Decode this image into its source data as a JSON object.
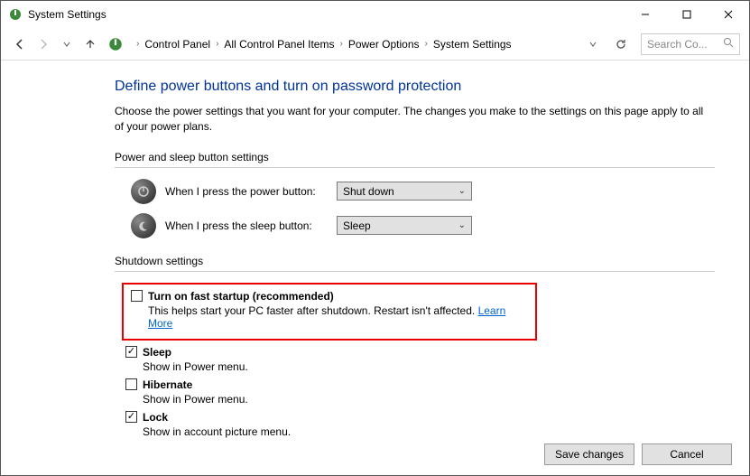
{
  "titlebar": {
    "title": "System Settings"
  },
  "breadcrumb": {
    "items": [
      "Control Panel",
      "All Control Panel Items",
      "Power Options",
      "System Settings"
    ]
  },
  "search": {
    "placeholder": "Search Co..."
  },
  "page": {
    "heading": "Define power buttons and turn on password protection",
    "description": "Choose the power settings that you want for your computer. The changes you make to the settings on this page apply to all of your power plans.",
    "section1_label": "Power and sleep button settings",
    "power_button_label": "When I press the power button:",
    "power_button_value": "Shut down",
    "sleep_button_label": "When I press the sleep button:",
    "sleep_button_value": "Sleep",
    "section2_label": "Shutdown settings",
    "fast_startup": {
      "title": "Turn on fast startup (recommended)",
      "sub": "This helps start your PC faster after shutdown. Restart isn't affected. ",
      "learn": "Learn More"
    },
    "sleep": {
      "title": "Sleep",
      "sub": "Show in Power menu."
    },
    "hibernate": {
      "title": "Hibernate",
      "sub": "Show in Power menu."
    },
    "lock": {
      "title": "Lock",
      "sub": "Show in account picture menu."
    }
  },
  "footer": {
    "save": "Save changes",
    "cancel": "Cancel"
  }
}
